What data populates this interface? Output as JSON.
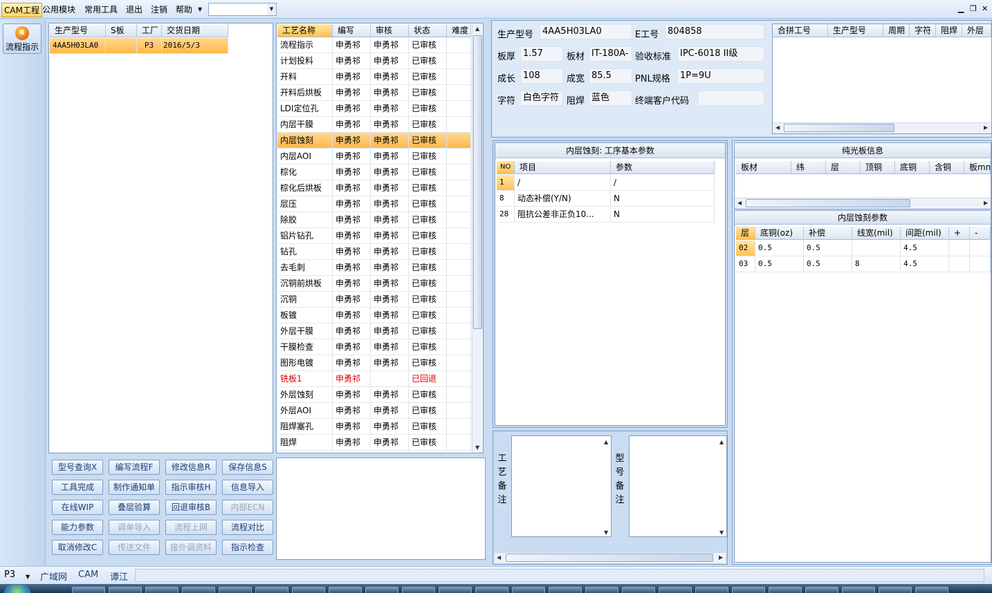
{
  "menubar": {
    "items": [
      "CAM工程",
      "公用模块",
      "常用工具",
      "退出",
      "注销",
      "帮助"
    ],
    "combo_value": ""
  },
  "nav": {
    "flow_label": "流程指示"
  },
  "models_table": {
    "headers": [
      "生产型号",
      "S板",
      "工厂",
      "交货日期"
    ],
    "rows": [
      [
        "4AA5H03LA0",
        "",
        "P3",
        "2016/5/3"
      ]
    ]
  },
  "process_table": {
    "headers": [
      "工艺名称",
      "编写",
      "审核",
      "状态",
      "难度"
    ],
    "rows": [
      [
        "流程指示",
        "申勇祁",
        "申勇祁",
        "已审核",
        ""
      ],
      [
        "计划投料",
        "申勇祁",
        "申勇祁",
        "已审核",
        ""
      ],
      [
        "开料",
        "申勇祁",
        "申勇祁",
        "已审核",
        ""
      ],
      [
        "开料后烘板",
        "申勇祁",
        "申勇祁",
        "已审核",
        ""
      ],
      [
        "LDI定位孔",
        "申勇祁",
        "申勇祁",
        "已审核",
        ""
      ],
      [
        "内层干膜",
        "申勇祁",
        "申勇祁",
        "已审核",
        ""
      ],
      [
        "内层蚀刻",
        "申勇祁",
        "申勇祁",
        "已审核",
        ""
      ],
      [
        "内层AOI",
        "申勇祁",
        "申勇祁",
        "已审核",
        ""
      ],
      [
        "棕化",
        "申勇祁",
        "申勇祁",
        "已审核",
        ""
      ],
      [
        "棕化后烘板",
        "申勇祁",
        "申勇祁",
        "已审核",
        ""
      ],
      [
        "层压",
        "申勇祁",
        "申勇祁",
        "已审核",
        ""
      ],
      [
        "除胶",
        "申勇祁",
        "申勇祁",
        "已审核",
        ""
      ],
      [
        "铝片钻孔",
        "申勇祁",
        "申勇祁",
        "已审核",
        ""
      ],
      [
        "钻孔",
        "申勇祁",
        "申勇祁",
        "已审核",
        ""
      ],
      [
        "去毛刺",
        "申勇祁",
        "申勇祁",
        "已审核",
        ""
      ],
      [
        "沉铜前烘板",
        "申勇祁",
        "申勇祁",
        "已审核",
        ""
      ],
      [
        "沉铜",
        "申勇祁",
        "申勇祁",
        "已审核",
        ""
      ],
      [
        "板镀",
        "申勇祁",
        "申勇祁",
        "已审核",
        ""
      ],
      [
        "外层干膜",
        "申勇祁",
        "申勇祁",
        "已审核",
        ""
      ],
      [
        "干膜检查",
        "申勇祁",
        "申勇祁",
        "已审核",
        ""
      ],
      [
        "图形电镀",
        "申勇祁",
        "申勇祁",
        "已审核",
        ""
      ],
      [
        "铣板1",
        "申勇祁",
        "",
        "已回退",
        ""
      ],
      [
        "外层蚀刻",
        "申勇祁",
        "申勇祁",
        "已审核",
        ""
      ],
      [
        "外层AOI",
        "申勇祁",
        "申勇祁",
        "已审核",
        ""
      ],
      [
        "阻焊塞孔",
        "申勇祁",
        "申勇祁",
        "已审核",
        ""
      ],
      [
        "阻焊",
        "申勇祁",
        "申勇祁",
        "已审核",
        ""
      ]
    ],
    "selected_index": 6,
    "returned_index": 21
  },
  "buttons": [
    [
      "型号查询X",
      "编写流程F",
      "修改信息R",
      "保存信息S"
    ],
    [
      "工具完成",
      "制作通知单",
      "指示审核H",
      "信息导入"
    ],
    [
      "在线WIP",
      "叠层验算",
      "回退审核B",
      "内部ECN"
    ],
    [
      "能力参数",
      "调单导入",
      "流程上网",
      "流程对比"
    ],
    [
      "取消修改C",
      "传送文件",
      "接外调资料",
      "指示检查"
    ]
  ],
  "disabled_buttons": [
    "内部ECN",
    "调单导入",
    "流程上网",
    "传送文件",
    "接外调资料"
  ],
  "product_info": {
    "labels": {
      "model": "生产型号",
      "e_no": "E工号",
      "thickness": "板厚",
      "material": "板材",
      "standard": "验收标准",
      "length": "成长",
      "width": "成宽",
      "pnl": "PNL规格",
      "silk": "字符",
      "mask": "阻焊",
      "customer": "终端客户代码"
    },
    "values": {
      "model": "4AA5H03LA0",
      "e_no": "804858",
      "thickness": "1.57",
      "material": "IT-180A-",
      "standard": "IPC-6018 II级",
      "length": "108",
      "width": "85.5",
      "pnl": "1P=9U",
      "silk": "白色字符",
      "mask": "蓝色",
      "customer": ""
    }
  },
  "merged_table": {
    "headers": [
      "合拼工号",
      "生产型号",
      "周期",
      "字符",
      "阻焊",
      "外层"
    ]
  },
  "basic_params": {
    "title": "内层蚀刻: 工序基本参数",
    "headers": [
      "NO",
      "项目",
      "参数"
    ],
    "rows": [
      [
        "1",
        "/",
        "/"
      ],
      [
        "8",
        "动态补偿(Y/N)",
        "N"
      ],
      [
        "28",
        "阻抗公差非正负10...",
        "N"
      ]
    ]
  },
  "plain_board": {
    "title": "纯光板信息",
    "headers": [
      "板材",
      "纬",
      "层",
      "顶铜",
      "底铜",
      "含铜",
      "板mm"
    ]
  },
  "etch_params": {
    "title": "内层蚀刻参数",
    "headers": [
      "层",
      "底铜(oz)",
      "补偿",
      "线宽(mil)",
      "间距(mil)",
      "+",
      "-"
    ],
    "rows": [
      [
        "02",
        "0.5",
        "0.5",
        "",
        "4.5",
        "",
        ""
      ],
      [
        "03",
        "0.5",
        "0.5",
        "8",
        "4.5",
        "",
        ""
      ]
    ]
  },
  "remarks": {
    "process_label": "工艺备注",
    "model_label": "型号备注"
  },
  "statusbar": {
    "tabs": [
      "P3",
      "广域网",
      "CAM",
      "谭江"
    ]
  },
  "colors": {
    "accent": "#ffc24f",
    "background": "#c9dcf2",
    "returned": "#e20000"
  }
}
